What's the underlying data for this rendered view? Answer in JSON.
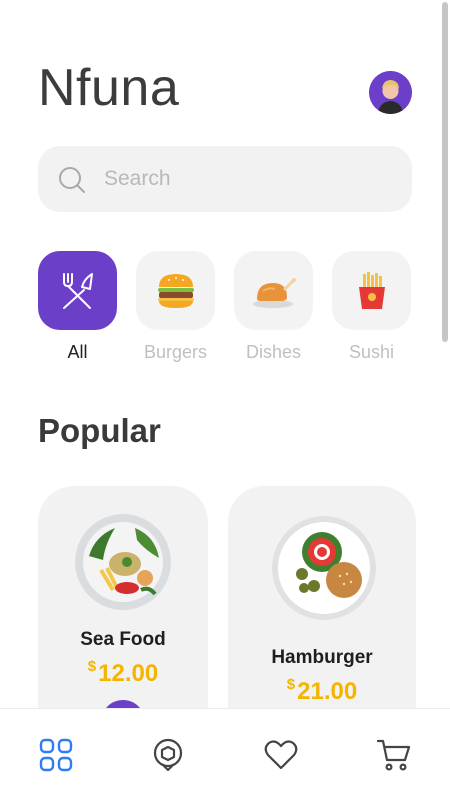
{
  "app": {
    "title": "Nfuna"
  },
  "search": {
    "placeholder": "Search",
    "value": ""
  },
  "categories": [
    {
      "label": "All",
      "icon": "fork-knife-icon",
      "active": true
    },
    {
      "label": "Burgers",
      "icon": "burger-icon",
      "active": false
    },
    {
      "label": "Dishes",
      "icon": "roast-chicken-icon",
      "active": false
    },
    {
      "label": "Sushi",
      "icon": "fries-icon",
      "active": false
    }
  ],
  "popular": {
    "title": "Popular",
    "items": [
      {
        "name": "Sea Food",
        "currency": "$",
        "price": "12.00",
        "icon": "seafood-plate-icon"
      },
      {
        "name": "Hamburger",
        "currency": "$",
        "price": "21.00",
        "icon": "hamburger-plate-icon"
      }
    ]
  },
  "nav": [
    {
      "icon": "grid-icon",
      "active": true
    },
    {
      "icon": "location-pin-icon",
      "active": false
    },
    {
      "icon": "heart-icon",
      "active": false
    },
    {
      "icon": "cart-icon",
      "active": false
    }
  ],
  "colors": {
    "accent": "#6c3fc9",
    "price": "#f5b400",
    "active_nav": "#2f7cf6",
    "card_bg": "#f2f2f2"
  }
}
